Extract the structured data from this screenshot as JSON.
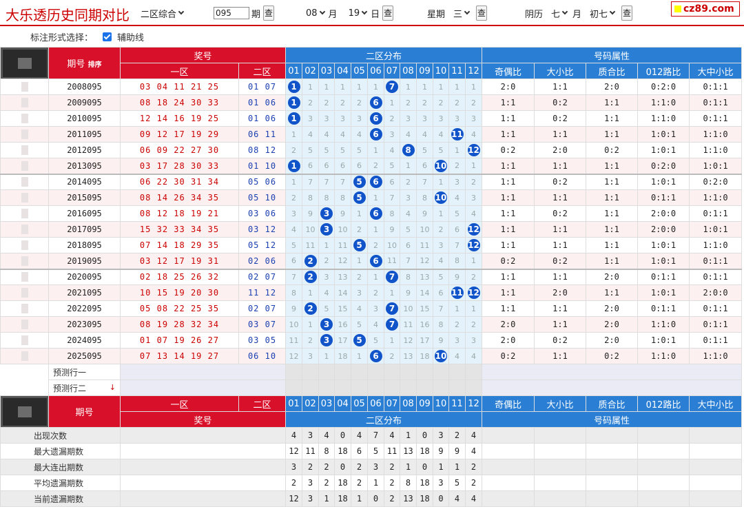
{
  "header": {
    "title": "大乐透历史同期对比",
    "mode": "二区综合",
    "issue_value": "095",
    "issue_label": "期",
    "query": "查",
    "month_value": "08",
    "month_label": "月",
    "day_value": "19",
    "day_label": "日",
    "week_label": "星期",
    "week_value": "三",
    "lunar_label": "阴历",
    "lunar_month": "七",
    "lunar_month_label": "月",
    "lunar_day": "初七",
    "logo": "cz89.com"
  },
  "options": {
    "label": "标注形式选择：",
    "aux_line": "辅助线"
  },
  "table": {
    "h_period": "期号",
    "h_sort": "排序",
    "h_prize": "奖号",
    "h_zone2dist": "二区分布",
    "h_attr": "号码属性",
    "h_zone1": "一区",
    "h_zone2": "二区",
    "cols": [
      "01",
      "02",
      "03",
      "04",
      "05",
      "06",
      "07",
      "08",
      "09",
      "10",
      "11",
      "12"
    ],
    "attr_cols": [
      "奇偶比",
      "大小比",
      "质合比",
      "012路比",
      "大中小比"
    ],
    "rows": [
      {
        "period": "2008095",
        "red": "03 04 11 21 25",
        "blue": "01 07",
        "dist": [
          "1",
          "1",
          "1",
          "1",
          "1",
          "1",
          "7",
          "1",
          "1",
          "1",
          "1",
          "1"
        ],
        "hits": [
          0,
          6
        ],
        "attr": [
          "2:0",
          "1:1",
          "2:0",
          "0:2:0",
          "0:1:1"
        ]
      },
      {
        "period": "2009095",
        "red": "08 18 24 30 33",
        "blue": "01 06",
        "dist": [
          "1",
          "2",
          "2",
          "2",
          "2",
          "6",
          "1",
          "2",
          "2",
          "2",
          "2",
          "2"
        ],
        "hits": [
          0,
          5
        ],
        "attr": [
          "1:1",
          "0:2",
          "1:1",
          "1:1:0",
          "0:1:1"
        ]
      },
      {
        "period": "2010095",
        "red": "12 14 16 19 25",
        "blue": "01 06",
        "dist": [
          "1",
          "3",
          "3",
          "3",
          "3",
          "6",
          "2",
          "3",
          "3",
          "3",
          "3",
          "3"
        ],
        "hits": [
          0,
          5
        ],
        "attr": [
          "1:1",
          "0:2",
          "1:1",
          "1:1:0",
          "0:1:1"
        ]
      },
      {
        "period": "2011095",
        "red": "09 12 17 19 29",
        "blue": "06 11",
        "dist": [
          "1",
          "4",
          "4",
          "4",
          "4",
          "6",
          "3",
          "4",
          "4",
          "4",
          "11",
          "4"
        ],
        "hits": [
          5,
          10
        ],
        "attr": [
          "1:1",
          "1:1",
          "1:1",
          "1:0:1",
          "1:1:0"
        ]
      },
      {
        "period": "2012095",
        "red": "06 09 22 27 30",
        "blue": "08 12",
        "dist": [
          "2",
          "5",
          "5",
          "5",
          "5",
          "1",
          "4",
          "8",
          "5",
          "5",
          "1",
          "12"
        ],
        "hits": [
          7,
          11
        ],
        "attr": [
          "0:2",
          "2:0",
          "0:2",
          "1:0:1",
          "1:1:0"
        ]
      },
      {
        "period": "2013095",
        "red": "03 17 28 30 33",
        "blue": "01 10",
        "dist": [
          "1",
          "6",
          "6",
          "6",
          "6",
          "2",
          "5",
          "1",
          "6",
          "10",
          "2",
          "1"
        ],
        "hits": [
          0,
          9
        ],
        "attr": [
          "1:1",
          "1:1",
          "1:1",
          "0:2:0",
          "1:0:1"
        ]
      },
      {
        "period": "2014095",
        "red": "06 22 30 31 34",
        "blue": "05 06",
        "dist": [
          "1",
          "7",
          "7",
          "7",
          "5",
          "6",
          "6",
          "2",
          "7",
          "1",
          "3",
          "2"
        ],
        "hits": [
          4,
          5
        ],
        "attr": [
          "1:1",
          "0:2",
          "1:1",
          "1:0:1",
          "0:2:0"
        ]
      },
      {
        "period": "2015095",
        "red": "08 14 26 34 35",
        "blue": "05 10",
        "dist": [
          "2",
          "8",
          "8",
          "8",
          "5",
          "1",
          "7",
          "3",
          "8",
          "10",
          "4",
          "3"
        ],
        "hits": [
          4,
          9
        ],
        "attr": [
          "1:1",
          "1:1",
          "1:1",
          "0:1:1",
          "1:1:0"
        ]
      },
      {
        "period": "2016095",
        "red": "08 12 18 19 21",
        "blue": "03 06",
        "dist": [
          "3",
          "9",
          "3",
          "9",
          "1",
          "6",
          "8",
          "4",
          "9",
          "1",
          "5",
          "4"
        ],
        "hits": [
          2,
          5
        ],
        "attr": [
          "1:1",
          "0:2",
          "1:1",
          "2:0:0",
          "0:1:1"
        ]
      },
      {
        "period": "2017095",
        "red": "15 32 33 34 35",
        "blue": "03 12",
        "dist": [
          "4",
          "10",
          "3",
          "10",
          "2",
          "1",
          "9",
          "5",
          "10",
          "2",
          "6",
          "12"
        ],
        "hits": [
          2,
          11
        ],
        "attr": [
          "1:1",
          "1:1",
          "1:1",
          "2:0:0",
          "1:0:1"
        ]
      },
      {
        "period": "2018095",
        "red": "07 14 18 29 35",
        "blue": "05 12",
        "dist": [
          "5",
          "11",
          "1",
          "11",
          "5",
          "2",
          "10",
          "6",
          "11",
          "3",
          "7",
          "12"
        ],
        "hits": [
          4,
          11
        ],
        "attr": [
          "1:1",
          "1:1",
          "1:1",
          "1:0:1",
          "1:1:0"
        ]
      },
      {
        "period": "2019095",
        "red": "03 12 17 19 31",
        "blue": "02 06",
        "dist": [
          "6",
          "2",
          "2",
          "12",
          "1",
          "6",
          "11",
          "7",
          "12",
          "4",
          "8",
          "1"
        ],
        "hits": [
          1,
          5
        ],
        "attr": [
          "0:2",
          "0:2",
          "1:1",
          "1:0:1",
          "0:1:1"
        ]
      },
      {
        "period": "2020095",
        "red": "02 18 25 26 32",
        "blue": "02 07",
        "dist": [
          "7",
          "2",
          "3",
          "13",
          "2",
          "1",
          "7",
          "8",
          "13",
          "5",
          "9",
          "2"
        ],
        "hits": [
          1,
          6
        ],
        "attr": [
          "1:1",
          "1:1",
          "2:0",
          "0:1:1",
          "0:1:1"
        ]
      },
      {
        "period": "2021095",
        "red": "10 15 19 20 30",
        "blue": "11 12",
        "dist": [
          "8",
          "1",
          "4",
          "14",
          "3",
          "2",
          "1",
          "9",
          "14",
          "6",
          "11",
          "12"
        ],
        "hits": [
          10,
          11
        ],
        "attr": [
          "1:1",
          "2:0",
          "1:1",
          "1:0:1",
          "2:0:0"
        ]
      },
      {
        "period": "2022095",
        "red": "05 08 22 25 35",
        "blue": "02 07",
        "dist": [
          "9",
          "2",
          "5",
          "15",
          "4",
          "3",
          "7",
          "10",
          "15",
          "7",
          "1",
          "1"
        ],
        "hits": [
          1,
          6
        ],
        "attr": [
          "1:1",
          "1:1",
          "2:0",
          "0:1:1",
          "0:1:1"
        ]
      },
      {
        "period": "2023095",
        "red": "08 19 28 32 34",
        "blue": "03 07",
        "dist": [
          "10",
          "1",
          "3",
          "16",
          "5",
          "4",
          "7",
          "11",
          "16",
          "8",
          "2",
          "2"
        ],
        "hits": [
          2,
          6
        ],
        "attr": [
          "2:0",
          "1:1",
          "2:0",
          "1:1:0",
          "0:1:1"
        ]
      },
      {
        "period": "2024095",
        "red": "01 07 19 26 27",
        "blue": "03 05",
        "dist": [
          "11",
          "2",
          "3",
          "17",
          "5",
          "5",
          "1",
          "12",
          "17",
          "9",
          "3",
          "3"
        ],
        "hits": [
          2,
          4
        ],
        "attr": [
          "2:0",
          "0:2",
          "2:0",
          "1:0:1",
          "0:1:1"
        ]
      },
      {
        "period": "2025095",
        "red": "07 13 14 19 27",
        "blue": "06 10",
        "dist": [
          "12",
          "3",
          "1",
          "18",
          "1",
          "6",
          "2",
          "13",
          "18",
          "10",
          "4",
          "4"
        ],
        "hits": [
          5,
          9
        ],
        "attr": [
          "0:2",
          "1:1",
          "0:2",
          "1:1:0",
          "1:1:0"
        ]
      }
    ],
    "predict1": "预测行一",
    "predict2": "预测行二",
    "stats": [
      {
        "label": "出现次数",
        "vals": [
          "4",
          "3",
          "4",
          "0",
          "4",
          "7",
          "4",
          "1",
          "0",
          "3",
          "2",
          "4"
        ]
      },
      {
        "label": "最大遗漏期数",
        "vals": [
          "12",
          "11",
          "8",
          "18",
          "6",
          "5",
          "11",
          "13",
          "18",
          "9",
          "9",
          "4"
        ]
      },
      {
        "label": "最大连出期数",
        "vals": [
          "3",
          "2",
          "2",
          "0",
          "2",
          "3",
          "2",
          "1",
          "0",
          "1",
          "1",
          "2"
        ]
      },
      {
        "label": "平均遗漏期数",
        "vals": [
          "2",
          "3",
          "2",
          "18",
          "2",
          "1",
          "2",
          "8",
          "18",
          "3",
          "5",
          "2"
        ]
      },
      {
        "label": "当前遗漏期数",
        "vals": [
          "12",
          "3",
          "1",
          "18",
          "1",
          "0",
          "2",
          "13",
          "18",
          "0",
          "4",
          "4"
        ]
      }
    ]
  }
}
